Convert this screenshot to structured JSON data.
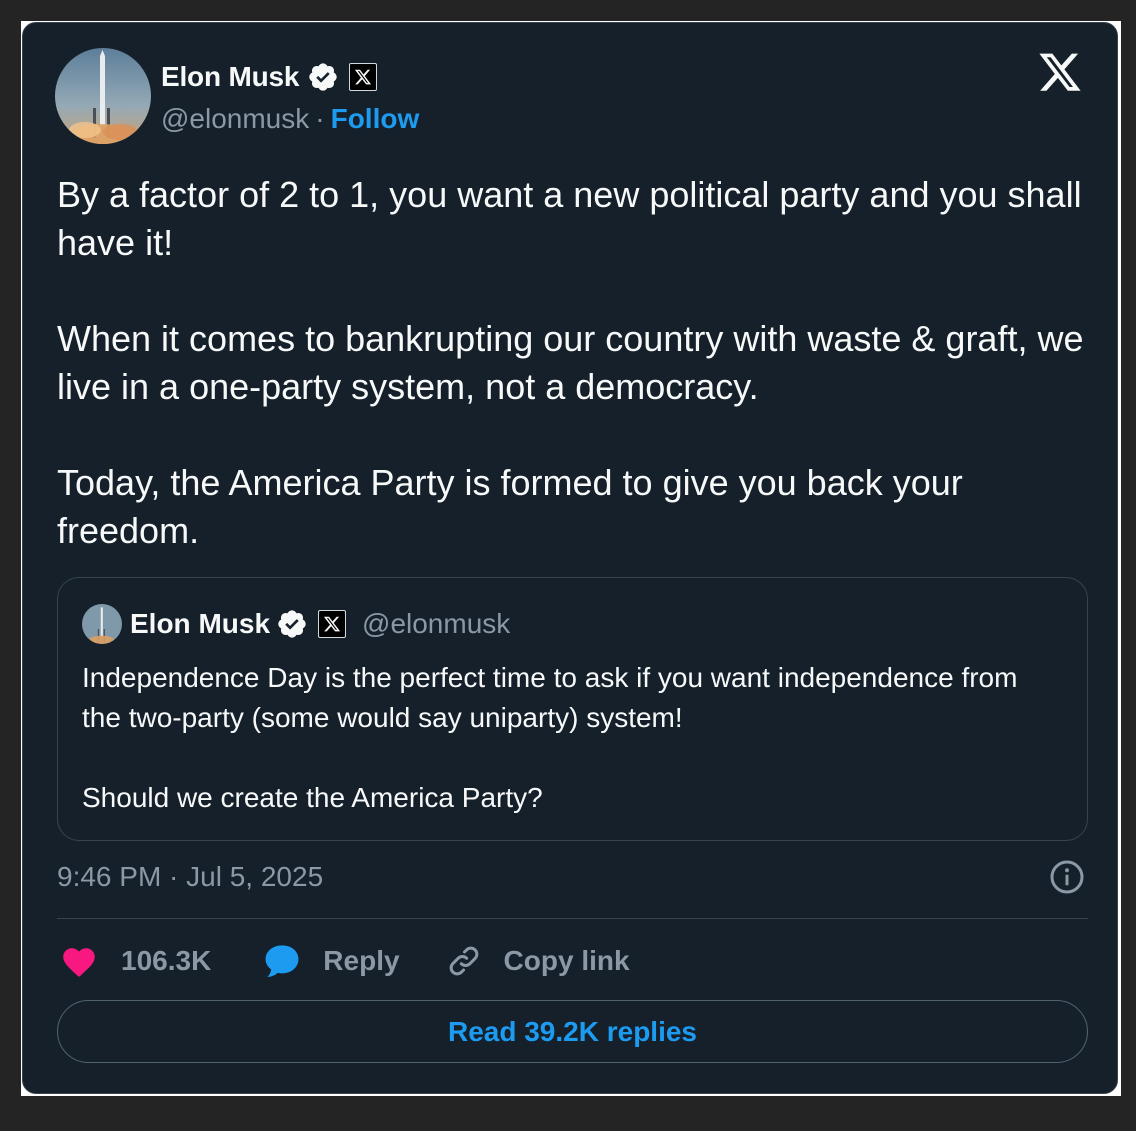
{
  "author": {
    "name": "Elon Musk",
    "handle": "@elonmusk",
    "separator": "·",
    "follow_label": "Follow"
  },
  "tweet": {
    "paragraphs": [
      "By a factor of 2 to 1, you want a new political party and you shall have it!",
      "When it comes to bankrupting our country with waste & graft, we live in a one-party system, not a democracy.",
      "Today, the America Party is formed to give you back your freedom."
    ],
    "timestamp": "9:46 PM · Jul 5, 2025"
  },
  "quoted_tweet": {
    "name": "Elon Musk",
    "handle": "@elonmusk",
    "paragraphs": [
      "Independence Day is the perfect time to ask if you want independence from the two-party (some would say uniparty) system!",
      "Should we create the America Party?"
    ]
  },
  "actions": {
    "like_count": "106.3K",
    "reply_label": "Reply",
    "copy_link_label": "Copy link",
    "read_replies_label": "Read 39.2K replies"
  },
  "icons": {
    "logo": "x-logo-icon",
    "verified": "verified-badge-icon",
    "affiliate": "x-affiliate-badge-icon",
    "info": "info-icon",
    "like": "heart-icon",
    "reply": "speech-bubble-icon",
    "copy": "link-icon"
  },
  "colors": {
    "background": "#15202b",
    "text": "#f7f9f9",
    "secondary": "#8b98a5",
    "accent": "#1d9bf0",
    "like": "#f91880",
    "border": "#38444d"
  }
}
